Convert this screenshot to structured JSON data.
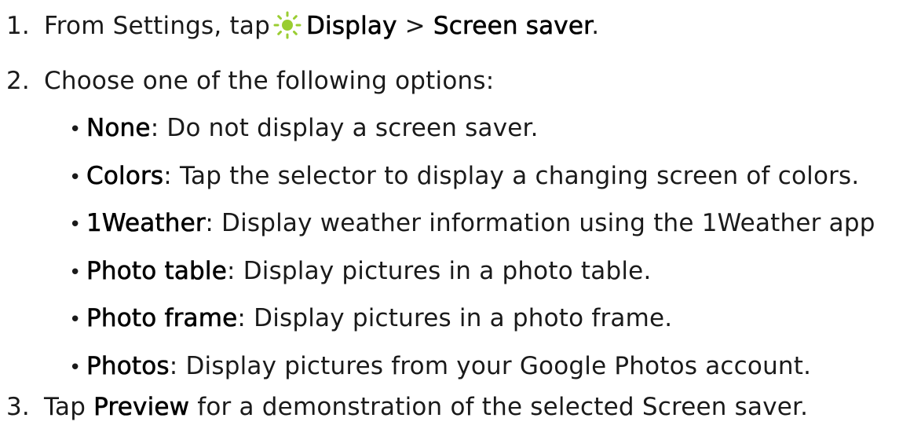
{
  "steps": [
    {
      "number": "1.",
      "prefix": "From Settings, tap",
      "icon": "sun-icon",
      "icon_color": "#9ACD32",
      "term1": "Display",
      "separator": " > ",
      "term2": "Screen saver",
      "suffix": "."
    },
    {
      "number": "2.",
      "text": "Choose one of the following options:"
    },
    {
      "number": "3.",
      "prefix": "Tap ",
      "term": "Preview",
      "suffix": " for a demonstration of the selected Screen saver."
    }
  ],
  "options": [
    {
      "term": "None",
      "desc": ": Do not display a screen saver."
    },
    {
      "term": "Colors",
      "desc": ": Tap the selector to display a changing screen of colors."
    },
    {
      "term": "1Weather",
      "desc": ": Display weather information using the 1Weather app"
    },
    {
      "term": "Photo table",
      "desc": ": Display pictures in a photo table."
    },
    {
      "term": "Photo frame",
      "desc": ": Display pictures in a photo frame."
    },
    {
      "term": "Photos",
      "desc": ": Display pictures from your Google Photos account."
    }
  ],
  "bullet": "•"
}
